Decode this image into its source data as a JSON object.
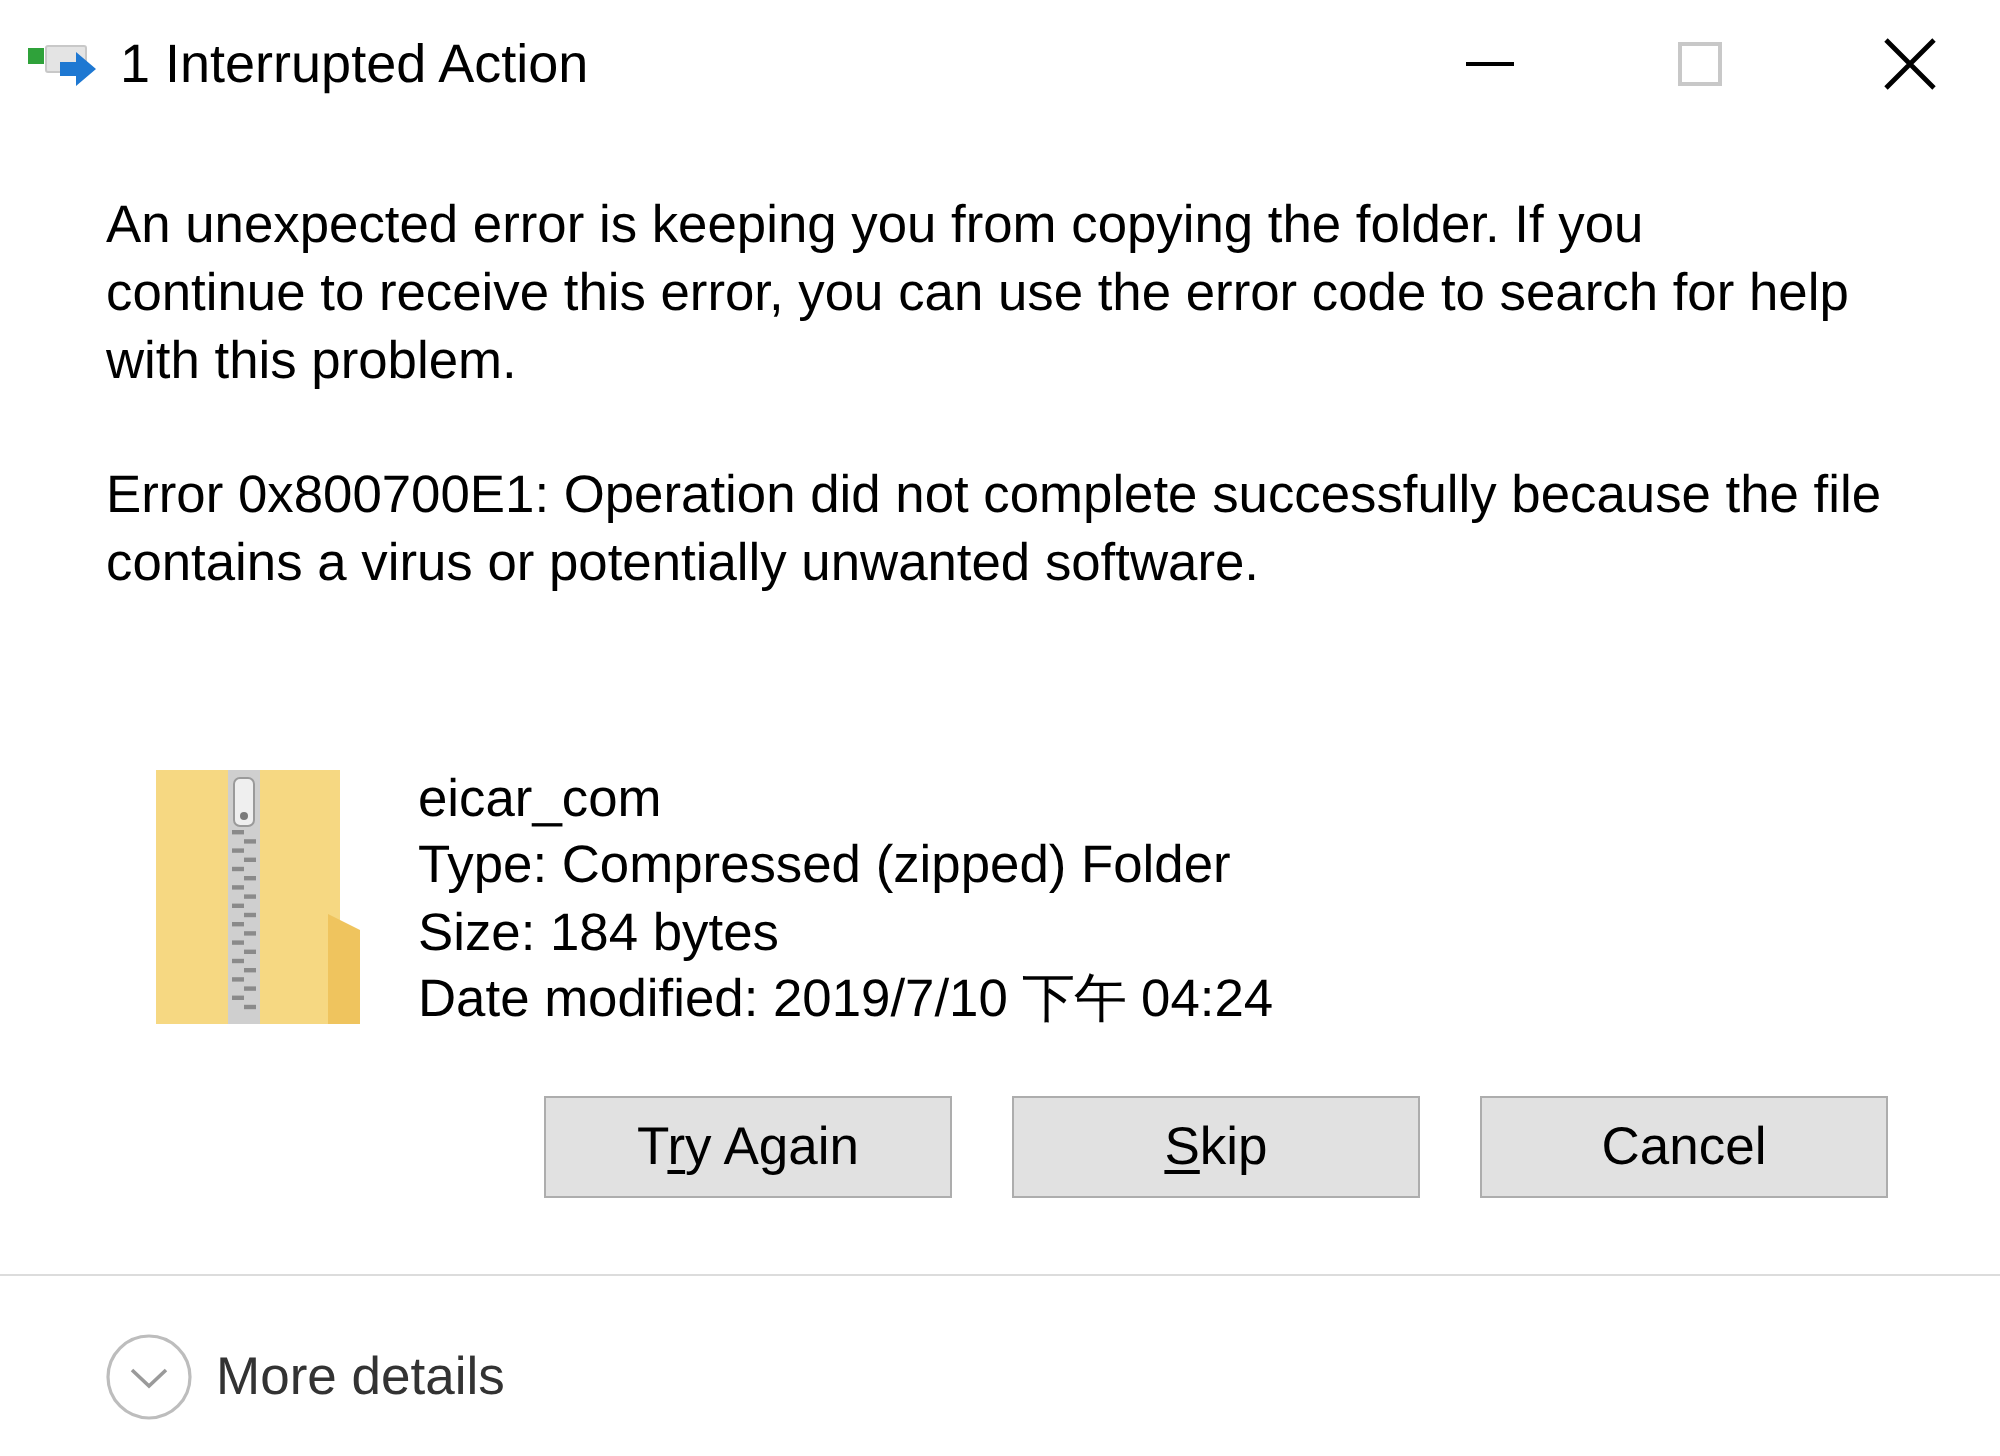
{
  "window": {
    "title": "1 Interrupted Action"
  },
  "window_controls": [
    {
      "kind": "minimize",
      "disabled": false
    },
    {
      "kind": "maximize",
      "disabled": true
    },
    {
      "kind": "close",
      "disabled": false
    }
  ],
  "message": "An unexpected error is keeping you from copying the folder. If you continue to receive this error, you can use the error code to search for help with this problem.",
  "error_detail": "Error 0x800700E1: Operation did not complete successfully because the file contains a virus or potentially unwanted software.",
  "file": {
    "name": "eicar_com",
    "details": [
      "Type: Compressed (zipped) Folder",
      "Size: 184 bytes",
      "Date modified: 2019/7/10 下午 04:24"
    ]
  },
  "buttons": [
    {
      "label_start": "T",
      "access_key": "r",
      "label_end": "y Again"
    },
    {
      "access_key": "S",
      "label_end": "kip"
    },
    {
      "label_start": "Cancel"
    }
  ],
  "more_details": {
    "label": "More details",
    "expanded": false
  }
}
